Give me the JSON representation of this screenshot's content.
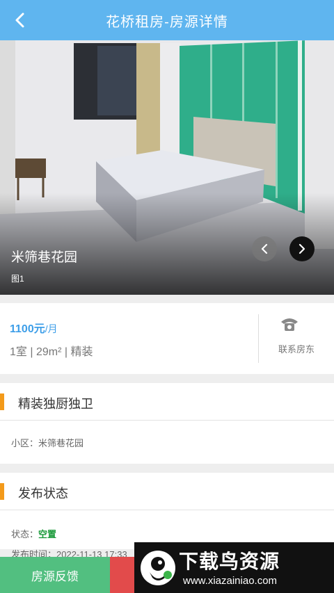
{
  "header": {
    "title": "花桥租房-房源详情",
    "back_icon": "chevron-left-icon"
  },
  "photo": {
    "caption": "米筛巷花园",
    "index_label": "图1",
    "prev_icon": "chevron-left-icon",
    "next_icon": "chevron-right-icon"
  },
  "price_card": {
    "price": "1100元",
    "unit": "/月",
    "specs": "1室 | 29m² | 精装",
    "contact_label": "联系房东",
    "contact_icon": "phone-icon"
  },
  "section1": {
    "title": "精装独厨独卫",
    "community_label": "小区：",
    "community_value": "米筛巷花园"
  },
  "section2": {
    "title": "发布状态",
    "status_label": "状态：",
    "status_value": "空置",
    "publish_time": "发布时间：2022-11-13 17:33"
  },
  "bottom": {
    "feedback_label": "房源反馈"
  },
  "watermark": {
    "title": "下载鸟资源",
    "url": "www.xiazainiao.com"
  },
  "colors": {
    "header": "#5fb5ef",
    "price": "#3d9ee8",
    "accent_bar": "#f39a1a",
    "status": "#1a9a3a",
    "feedback": "#52bf80",
    "red": "#e24b4b"
  }
}
